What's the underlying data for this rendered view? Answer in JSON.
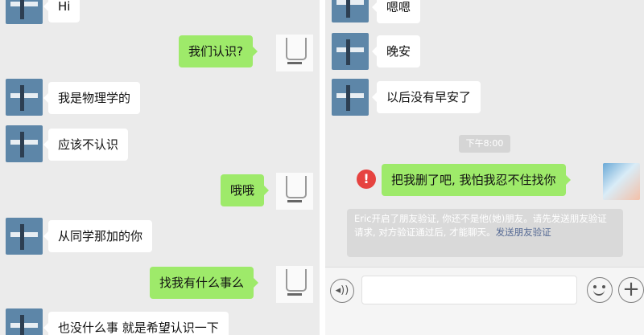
{
  "left_chat": {
    "messages": [
      {
        "side": "in",
        "text": "Hi"
      },
      {
        "side": "out",
        "text": "我们认识?"
      },
      {
        "side": "in",
        "text": "我是物理学的"
      },
      {
        "side": "in",
        "text": "应该不认识"
      },
      {
        "side": "out",
        "text": "哦哦"
      },
      {
        "side": "in",
        "text": "从同学那加的你"
      },
      {
        "side": "out",
        "text": "找我有什么事么"
      },
      {
        "side": "in",
        "text": "也没什么事 就是希望认识一下"
      }
    ]
  },
  "right_chat": {
    "messages": [
      {
        "side": "in",
        "text": "嗯嗯"
      },
      {
        "side": "in",
        "text": "晚安"
      },
      {
        "side": "in",
        "text": "以后没有早安了"
      }
    ],
    "time_label": "下午8:00",
    "failed_message": {
      "text": "把我删了吧, 我怕我忍不住找你",
      "error_icon": "!"
    },
    "system_notice": {
      "text": "Eric开启了朋友验证, 你还不是他(她)朋友。请先发送朋友验证请求, 对方验证通过后, 才能聊天。",
      "link": "发送朋友验证"
    },
    "input_bar": {
      "voice_icon": "voice-icon",
      "emoji_icon": "emoji-icon",
      "plus_label": "+"
    }
  },
  "colors": {
    "chat_bg": "#ebebeb",
    "outgoing_bubble": "#9eea6a",
    "incoming_bubble": "#ffffff",
    "link": "#576b95",
    "error": "#e64340"
  }
}
